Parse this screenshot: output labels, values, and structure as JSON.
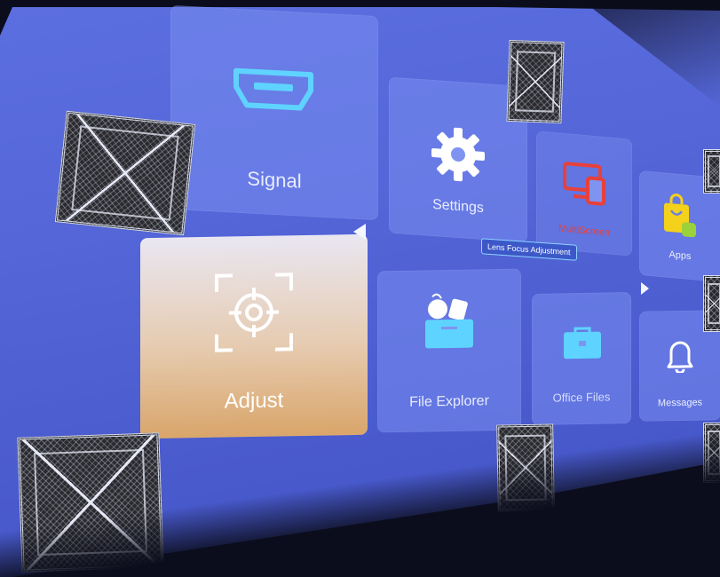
{
  "tiles": {
    "signal": {
      "label": "Signal",
      "icon": "hdmi-icon"
    },
    "settings": {
      "label": "Settings",
      "icon": "gear-icon"
    },
    "multiscreen": {
      "label": "MultiScreen",
      "icon": "screen-mirror-icon"
    },
    "apps": {
      "label": "Apps",
      "icon": "shopping-bag-android-icon"
    },
    "adjust": {
      "label": "Adjust",
      "icon": "focus-target-icon"
    },
    "file_explorer": {
      "label": "File Explorer",
      "icon": "folder-media-icon"
    },
    "office_files": {
      "label": "Office Files",
      "icon": "briefcase-icon"
    },
    "messages": {
      "label": "Messages",
      "icon": "bell-icon"
    }
  },
  "tooltip": {
    "text": "Lens Focus Adjustment"
  },
  "colors": {
    "screen_bg": "#5466d8",
    "tile_bg": "#7f93f0",
    "adjust_gradient_bottom": "#d9a56a",
    "multiscreen_red": "#e8403a",
    "apps_yellow": "#f4d11a",
    "icon_cyan": "#5fd3ff",
    "tooltip_border": "#8fd4ff"
  }
}
